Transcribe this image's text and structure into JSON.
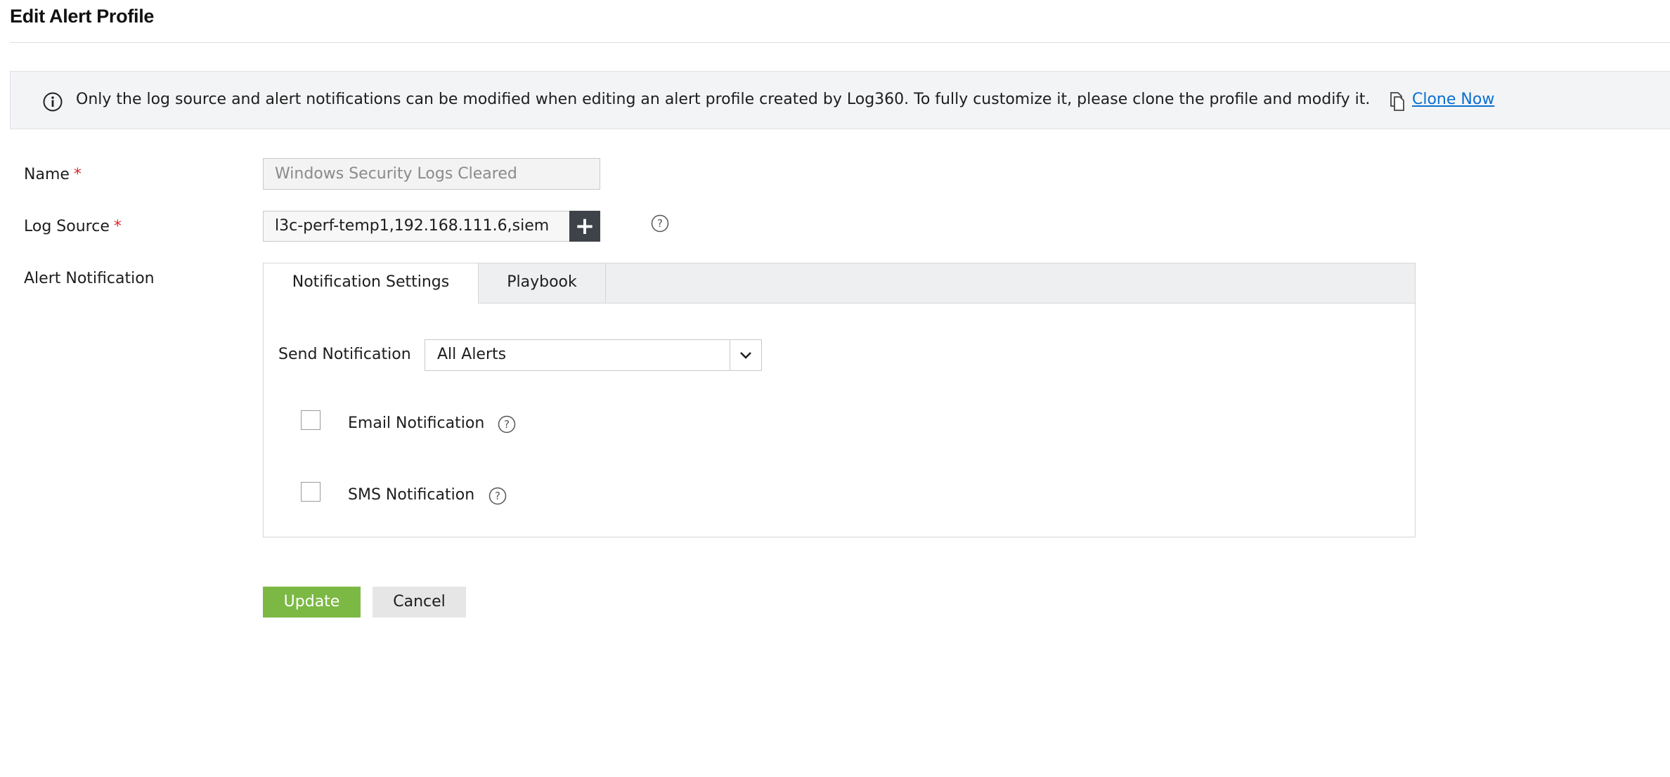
{
  "page": {
    "title": "Edit Alert Profile"
  },
  "banner": {
    "message": "Only the log source and alert notifications can be modified when editing an alert profile created by Log360. To fully customize it, please clone the profile and modify it.",
    "link_label": "Clone Now",
    "icon": "info-icon",
    "link_icon": "copy-icon"
  },
  "form": {
    "name_label": "Name",
    "name_value": "Windows Security Logs Cleared",
    "log_source_label": "Log Source",
    "log_source_value": "l3c-perf-temp1,192.168.111.6,siem",
    "required_mark": "*",
    "add_log_source_symbol": "+",
    "alert_notification_label": "Alert Notification"
  },
  "notification": {
    "tabs": [
      {
        "label": "Notification Settings",
        "active": true
      },
      {
        "label": "Playbook",
        "active": false
      }
    ],
    "send_label": "Send Notification",
    "send_selected": "All Alerts",
    "options": [
      {
        "label": "Email Notification",
        "checked": false
      },
      {
        "label": "SMS Notification",
        "checked": false
      }
    ]
  },
  "actions": {
    "update_label": "Update",
    "cancel_label": "Cancel"
  },
  "colors": {
    "accent_green": "#7cb944",
    "link_blue": "#0a6fd0",
    "required_red": "#e0262b",
    "plus_button": "#3d4349"
  }
}
